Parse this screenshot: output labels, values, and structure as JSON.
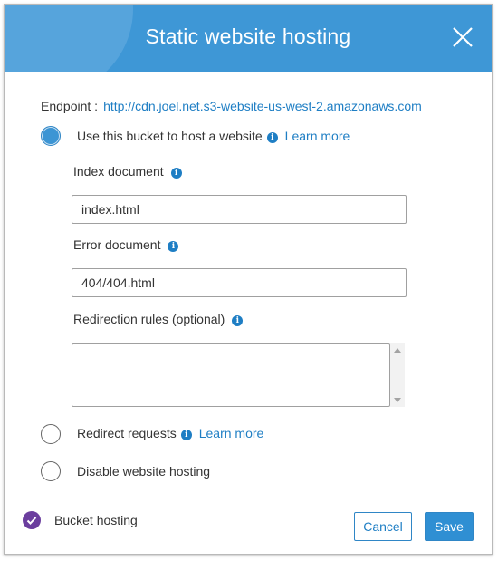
{
  "dialog": {
    "title": "Static website hosting",
    "header_color": "#3e97d6"
  },
  "endpoint": {
    "label": "Endpoint :",
    "url": "http://cdn.joel.net.s3-website-us-west-2.amazonaws.com"
  },
  "options": {
    "host_website": {
      "label": "Use this bucket to host a website",
      "learn_more": "Learn more",
      "selected": true
    },
    "redirect_requests": {
      "label": "Redirect requests",
      "learn_more": "Learn more",
      "selected": false
    },
    "disable_hosting": {
      "label": "Disable website hosting",
      "selected": false
    }
  },
  "fields": {
    "index_document": {
      "label": "Index document",
      "value": "index.html"
    },
    "error_document": {
      "label": "Error document",
      "value": "404/404.html"
    },
    "redirection_rules": {
      "label": "Redirection rules (optional)",
      "value": ""
    }
  },
  "footer": {
    "status_label": "Bucket hosting",
    "status_color": "#6b3e9e",
    "cancel_label": "Cancel",
    "save_label": "Save"
  },
  "icons": {
    "close": "close-icon",
    "info": "info-icon",
    "check": "check-icon"
  }
}
